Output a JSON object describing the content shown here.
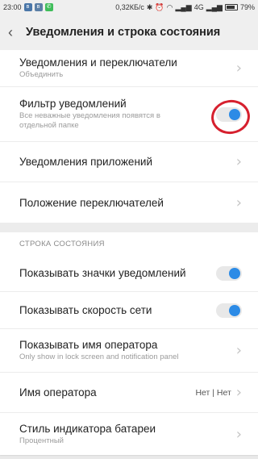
{
  "status_bar": {
    "time": "23:00",
    "left_icons": [
      "vk-icon",
      "vk-icon",
      "whatsapp-icon"
    ],
    "network_speed": "0,32КБ/с",
    "network_type": "4G",
    "battery": "79%"
  },
  "header": {
    "title": "Уведомления и строка состояния"
  },
  "group1": [
    {
      "title": "Уведомления и переключатели",
      "subtitle": "Объединить",
      "control": "chevron"
    },
    {
      "title": "Фильтр уведомлений",
      "subtitle": "Все неважные уведомления появятся в отдельной папке",
      "control": "toggle",
      "on": true
    },
    {
      "title": "Уведомления приложений",
      "control": "chevron"
    },
    {
      "title": "Положение переключателей",
      "control": "chevron"
    }
  ],
  "section": {
    "label": "СТРОКА СОСТОЯНИЯ"
  },
  "group2": [
    {
      "title": "Показывать значки уведомлений",
      "control": "toggle",
      "on": true
    },
    {
      "title": "Показывать скорость сети",
      "control": "toggle",
      "on": true
    },
    {
      "title": "Показывать имя оператора",
      "subtitle": "Only show in lock screen and notification panel",
      "control": "chevron"
    },
    {
      "title": "Имя оператора",
      "value": "Нет | Нет",
      "control": "chevron"
    },
    {
      "title": "Стиль индикатора батареи",
      "subtitle": "Процентный",
      "control": "chevron"
    }
  ],
  "colors": {
    "accent": "#2c8be6",
    "highlight": "#d6202e",
    "background": "#efefef"
  }
}
